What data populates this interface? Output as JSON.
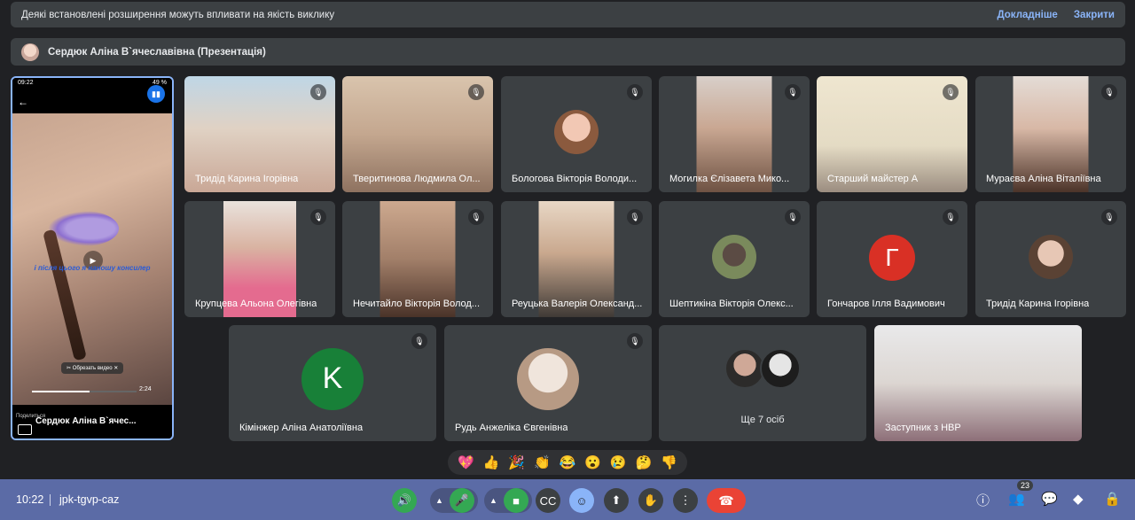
{
  "banner": {
    "message": "Деякі встановлені розширення можуть впливати на якість виклику",
    "details_link": "Докладніше",
    "close_link": "Закрити"
  },
  "presenter": {
    "label": "Сердюк Аліна В`ячеславівна (Презентація)"
  },
  "phone": {
    "status_time": "09:22",
    "battery": "49 %",
    "caption": "і після цього я наношу консилер",
    "trim_label": "Обрезать видео",
    "duration": "2:24",
    "progress": 0.55,
    "share_label": "Поделиться",
    "name": "Сердюк Аліна В`ячес..."
  },
  "tiles": [
    {
      "name": "Тридід Карина Ігорівна"
    },
    {
      "name": "Тверитинова Людмила Ол..."
    },
    {
      "name": "Бологова Вікторія Володи..."
    },
    {
      "name": "Могилка Єлізавета Мико..."
    },
    {
      "name": "Старший майстер А"
    },
    {
      "name": "Мураєва Аліна Віталіївна"
    },
    {
      "name": "Крупцева Альона Олегівна"
    },
    {
      "name": "Нечитайло Вікторія Волод..."
    },
    {
      "name": "Реуцька Валерія Олександ..."
    },
    {
      "name": "Шептикіна Вікторія Олекс..."
    },
    {
      "name": "Гончаров Ілля Вадимович",
      "letter": "Г",
      "color": "#d93025"
    },
    {
      "name": "Тридід Карина Ігорівна"
    },
    {
      "name": "Кімінжер Аліна Анатоліївна",
      "letter": "K",
      "color": "#188038"
    },
    {
      "name": "Рудь Анжеліка Євгенівна"
    },
    {
      "name": "Ще 7 осіб"
    },
    {
      "name": "Заступник з НВР"
    }
  ],
  "reactions": [
    "💖",
    "👍",
    "🎉",
    "👏",
    "😂",
    "😮",
    "😢",
    "🤔",
    "👎"
  ],
  "controls": {
    "time": "10:22",
    "meeting_code": "jpk-tgvp-caz",
    "participant_count": "23",
    "icons": [
      "audio-icon",
      "mic-icon",
      "camera-icon",
      "captions-icon",
      "emoji-icon",
      "present-icon",
      "hand-icon",
      "more-icon",
      "end-call-icon",
      "info-icon",
      "people-icon",
      "chat-icon",
      "activities-icon",
      "lock-icon"
    ]
  },
  "colors": {
    "accent": "#8ab4f8",
    "end_call": "#ea4335",
    "mic_on": "#34a853",
    "control_bar": "#5b6ba6"
  }
}
